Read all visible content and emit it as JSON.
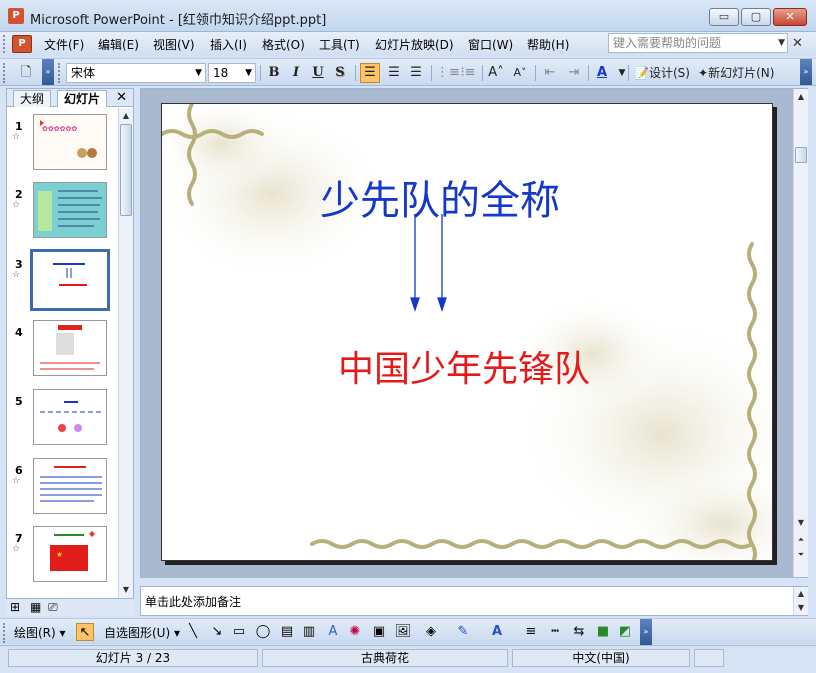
{
  "window": {
    "title": "Microsoft PowerPoint - [红领巾知识介绍ppt.ppt]",
    "app_icon_text": "P",
    "buttons": {
      "minimize": "▭",
      "maximize": "▢",
      "close": "✕"
    }
  },
  "menubar": {
    "items": [
      "文件(F)",
      "编辑(E)",
      "视图(V)",
      "插入(I)",
      "格式(O)",
      "工具(T)",
      "幻灯片放映(D)",
      "窗口(W)",
      "帮助(H)"
    ],
    "help_placeholder": "键入需要帮助的问题",
    "close_glyph": "✕"
  },
  "toolbar": {
    "font_name": "宋体",
    "font_size": "18",
    "bold": "B",
    "italic": "I",
    "underline": "U",
    "shadow": "S",
    "design_label": "设计(S)",
    "new_slide_label": "新幻灯片(N)"
  },
  "left_pane": {
    "tab_outline": "大纲",
    "tab_slides": "幻灯片",
    "close_glyph": "✕",
    "selected_slide": 3,
    "slides": [
      {
        "number": "1"
      },
      {
        "number": "2"
      },
      {
        "number": "3"
      },
      {
        "number": "4"
      },
      {
        "number": "5"
      },
      {
        "number": "6"
      },
      {
        "number": "7"
      }
    ]
  },
  "slide": {
    "title": "少先队的全称",
    "subtitle": "中国少年先锋队",
    "colors": {
      "title": "#1438c9",
      "subtitle": "#e41a1a",
      "arrows": "#1438c9"
    }
  },
  "notes": {
    "placeholder": "单击此处添加备注"
  },
  "drawing_toolbar": {
    "draw_label": "绘图(R)",
    "autoshapes_label": "自选图形(U)"
  },
  "statusbar": {
    "slide_position": "幻灯片 3 / 23",
    "design_name": "古典荷花",
    "language": "中文(中国)"
  }
}
